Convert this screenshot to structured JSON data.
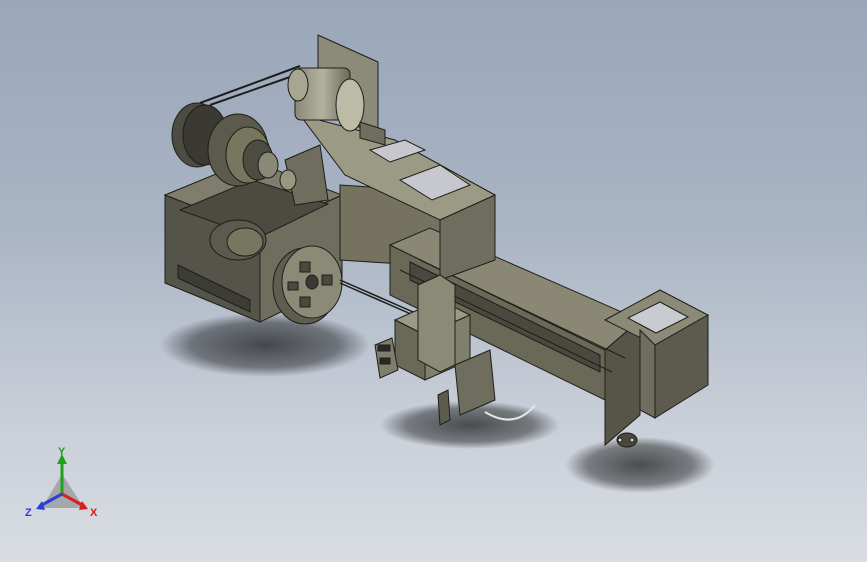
{
  "viewport": {
    "background_top": "#9aa7ba",
    "background_bottom": "#d9dde3"
  },
  "model": {
    "body_color": "#6f6e5e",
    "body_light": "#8c8a78",
    "body_dark": "#4a4940",
    "edge_color": "#1e1e1a"
  },
  "triad": {
    "x_label": "X",
    "y_label": "Y",
    "z_label": "Z",
    "x_color": "#d42020",
    "y_color": "#1fa31f",
    "z_color": "#2b3fd6"
  }
}
